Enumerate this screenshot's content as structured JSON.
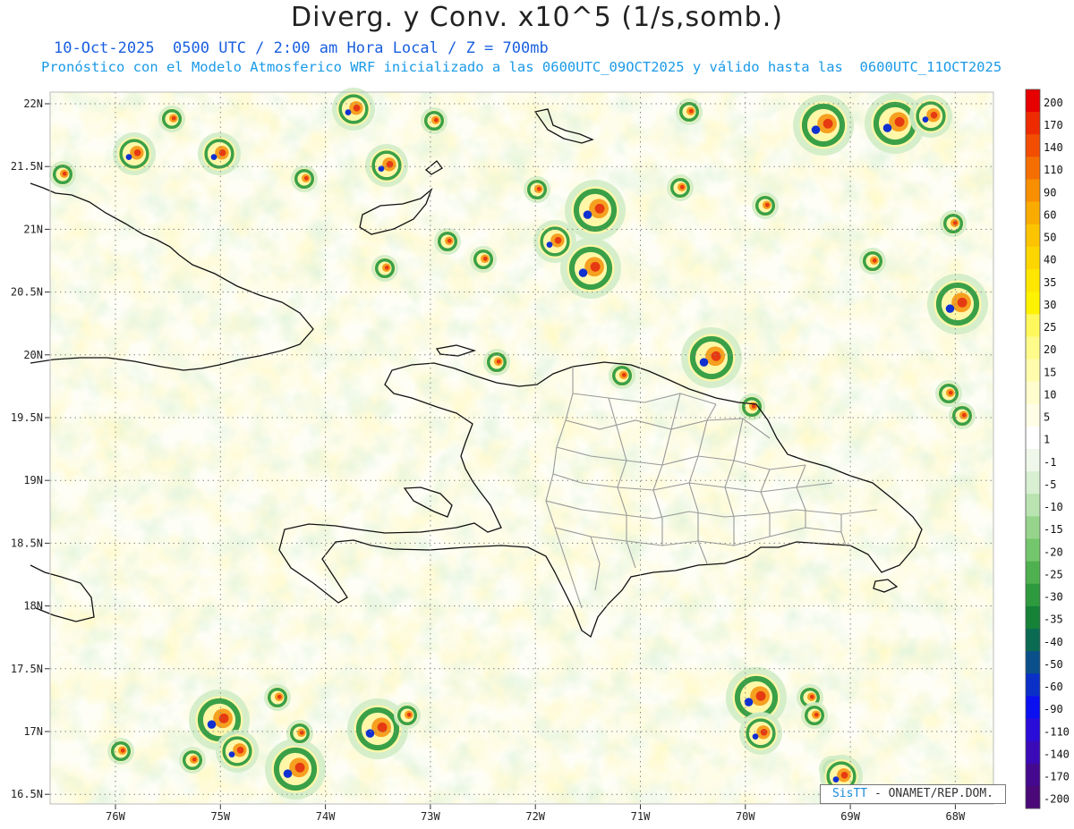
{
  "title": "Diverg. y Conv. x10^5 (1/s,somb.)",
  "subtitle_time": "10-Oct-2025  0500 UTC / 2:00 am Hora Local / Z = 700mb",
  "subtitle_model": "Pronóstico con el Modelo Atmosferico WRF inicializado a las 0600UTC_09OCT2025 y válido hasta las  0600UTC_11OCT2025",
  "credit": {
    "brand": "SisTT",
    "text": "- ONAMET/REP.DOM."
  },
  "lat_labels": [
    "22N",
    "21.5N",
    "21N",
    "20.5N",
    "20N",
    "19.5N",
    "19N",
    "18.5N",
    "18N",
    "17.5N",
    "17N",
    "16.5N"
  ],
  "lon_labels": [
    "76W",
    "75W",
    "74W",
    "73W",
    "72W",
    "71W",
    "70W",
    "69W",
    "68W"
  ],
  "colorbar": {
    "labels": [
      "200",
      "170",
      "140",
      "110",
      "90",
      "60",
      "50",
      "40",
      "35",
      "30",
      "25",
      "20",
      "15",
      "10",
      "5",
      "1",
      "-1",
      "-5",
      "-10",
      "-15",
      "-20",
      "-25",
      "-30",
      "-35",
      "-40",
      "-50",
      "-60",
      "-90",
      "-110",
      "-140",
      "-170",
      "-200"
    ],
    "colors": [
      "#e60000",
      "#ee2b00",
      "#f24d00",
      "#f56f00",
      "#f88f00",
      "#faab00",
      "#fcc400",
      "#fdd600",
      "#fee600",
      "#fff200",
      "#fff85c",
      "#fffb8a",
      "#fffcad",
      "#fffdce",
      "#fffde6",
      "#ffffff",
      "#eef7ea",
      "#d8efd2",
      "#b9e3b0",
      "#96d48c",
      "#74c66c",
      "#4fb04f",
      "#2e9a3e",
      "#158238",
      "#0b6b52",
      "#0a4f8a",
      "#0a30c8",
      "#0a10f0",
      "#2a0cd8",
      "#3a0ab8",
      "#44098f",
      "#4a0878"
    ]
  }
}
